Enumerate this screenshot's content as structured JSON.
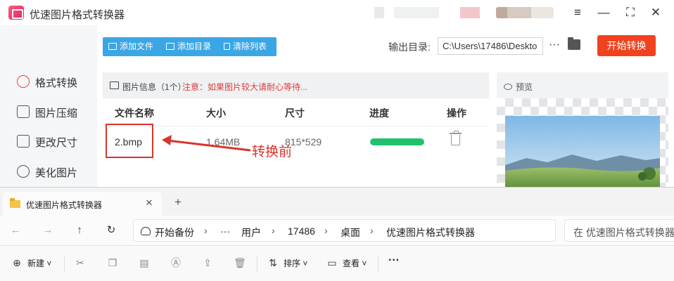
{
  "app": {
    "title": "优速图片格式转换器",
    "window_controls": [
      "menu-icon",
      "minimize-icon",
      "fullscreen-icon",
      "close-icon"
    ]
  },
  "sidebar": {
    "items": [
      {
        "label": "格式转换",
        "icon": "convert-icon",
        "active": true
      },
      {
        "label": "图片压缩",
        "icon": "compress-icon",
        "active": false
      },
      {
        "label": "更改尺寸",
        "icon": "resize-icon",
        "active": false
      },
      {
        "label": "美化图片",
        "icon": "beautify-icon",
        "active": false
      }
    ]
  },
  "toolbar": {
    "add_file": "添加文件",
    "add_dir": "添加目录",
    "clear_list": "清除列表",
    "output_label": "输出目录:",
    "output_path": "C:\\Users\\17486\\Deskto",
    "more": "···",
    "start": "开始转换"
  },
  "file_panel": {
    "info_title": "图片信息（1个）",
    "warning": "注意：如果图片较大请耐心等待...",
    "columns": [
      "文件名称",
      "大小",
      "尺寸",
      "进度",
      "操作"
    ],
    "rows": [
      {
        "name": "2.bmp",
        "size": "1.64MB",
        "dimensions": "815*529",
        "progress": 1.0
      }
    ]
  },
  "annotation": {
    "text": "转换前",
    "color": "#d9342b"
  },
  "preview": {
    "label": "预览"
  },
  "explorer": {
    "tab_label": "优速图片格式转换器",
    "tab_close": "✕",
    "new_tab": "+",
    "breadcrumbs": [
      "开始备份",
      "···",
      "用户",
      "17486",
      "桌面",
      "优速图片格式转换器"
    ],
    "search_placeholder": "在 优速图片格式转换器",
    "commands": {
      "new": "新建",
      "sort": "排序",
      "view": "查看",
      "more": "···"
    }
  },
  "colors": {
    "accent_blue": "#3ba6e5",
    "start_red": "#f0421f",
    "progress_green": "#20c16d",
    "warning_red": "#e03b3b"
  }
}
